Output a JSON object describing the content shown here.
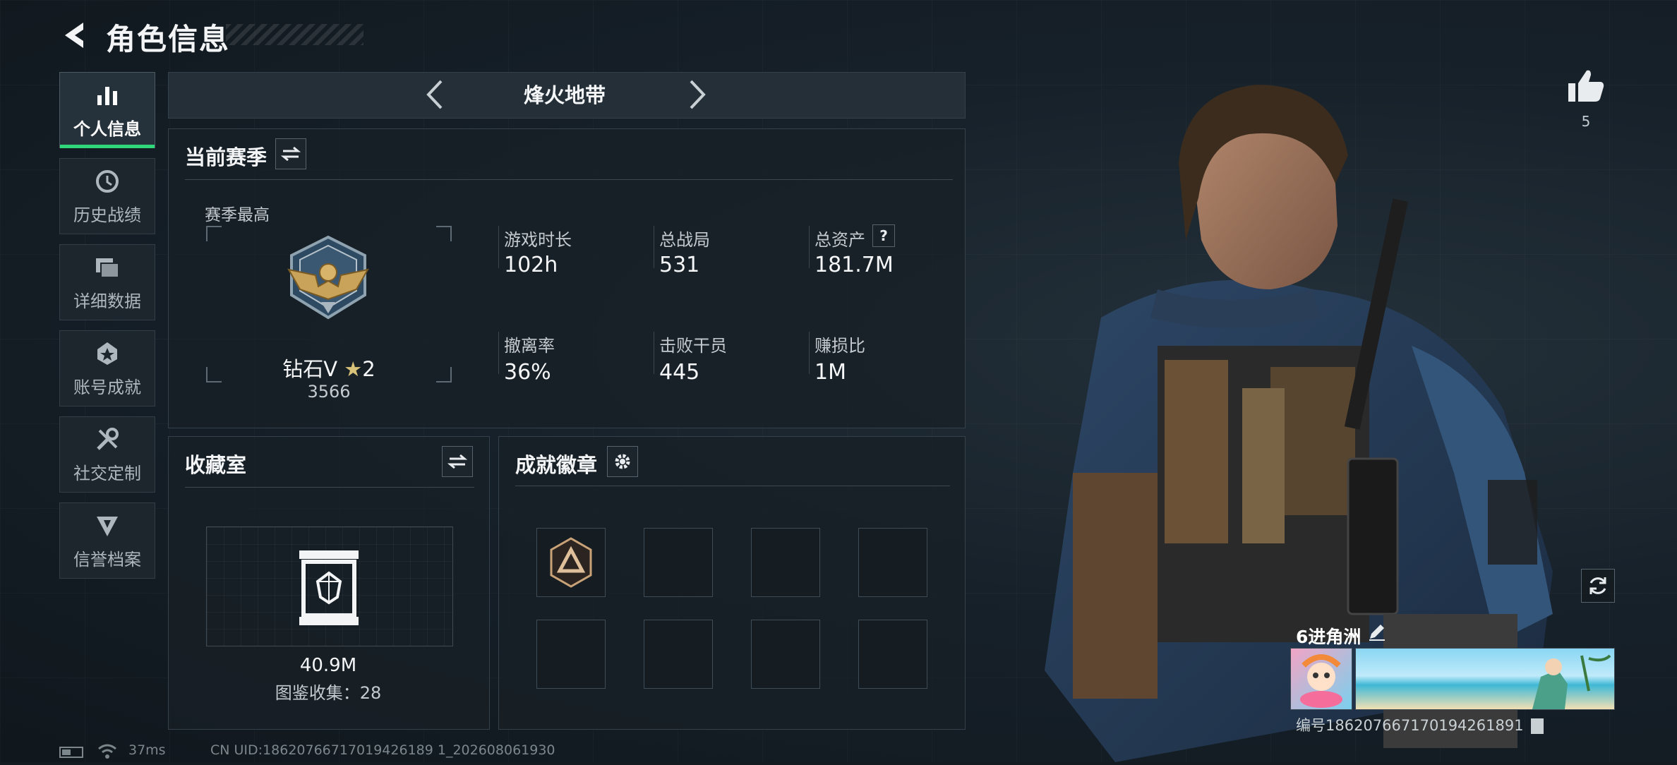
{
  "header": {
    "title": "角色信息"
  },
  "sidebar": {
    "items": [
      {
        "label": "个人信息",
        "icon": "bar-chart-icon",
        "active": true
      },
      {
        "label": "历史战绩",
        "icon": "history-icon",
        "active": false
      },
      {
        "label": "详细数据",
        "icon": "folders-icon",
        "active": false
      },
      {
        "label": "账号成就",
        "icon": "achievement-icon",
        "active": false
      },
      {
        "label": "社交定制",
        "icon": "tools-icon",
        "active": false
      },
      {
        "label": "信誉档案",
        "icon": "reputation-icon",
        "active": false
      }
    ]
  },
  "mode_selector": {
    "current": "烽火地带"
  },
  "season": {
    "title": "当前赛季",
    "best_label": "赛季最高",
    "rank_text": "钻石V",
    "rank_stars": "2",
    "rank_score": "3566",
    "stats": [
      {
        "label": "游戏时长",
        "value": "102h"
      },
      {
        "label": "总战局",
        "value": "531"
      },
      {
        "label": "总资产",
        "value": "181.7M",
        "help": "?"
      },
      {
        "label": "撤离率",
        "value": "36%"
      },
      {
        "label": "击败干员",
        "value": "445"
      },
      {
        "label": "赚损比",
        "value": "1M"
      }
    ]
  },
  "collection": {
    "title": "收藏室",
    "value": "40.9M",
    "catalog_label": "图鉴收集：28"
  },
  "badges": {
    "title": "成就徽章",
    "slot_count": 8
  },
  "profile": {
    "likes": "5",
    "player_name": "6进角洲",
    "uid_line": "编号1862076671701942618​91"
  },
  "status_bar": {
    "ping": "37ms",
    "cn_uid": "CN UID:18620766717019426189 1_202608061930"
  },
  "colors": {
    "accent": "#2fd77a",
    "panel": "#182026",
    "background": "#141c22"
  }
}
